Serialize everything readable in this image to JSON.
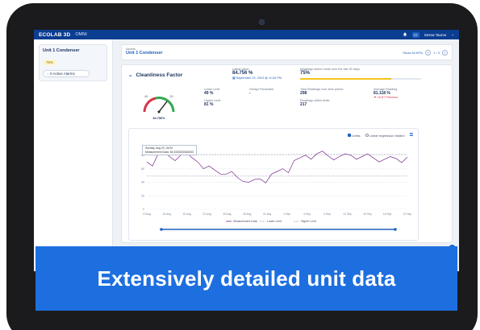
{
  "header": {
    "brand": "ECOLAB 3D",
    "app": "OMNI",
    "user_initials": "ST",
    "user_name": "Sesna Taurus"
  },
  "sidebar": {
    "unit_title": "Unit 1 Condenser",
    "unit_pct": "75%",
    "alarms": "0 Active Alarms"
  },
  "assets": {
    "label": "Assets",
    "unit": "Unit 1 Condenser",
    "show_all": "Show All KPIs",
    "page": "1 / 3"
  },
  "panel": {
    "title": "Cleanliness Factor",
    "latest_label": "Latest value",
    "latest_value": "84.756 %",
    "latest_date": "September 23, 2023 @ 11:00 PM",
    "within_label": "Readings within Limits over the last 30 days",
    "within_value": "75%",
    "within_fill": 0.75,
    "gauge_value": "84.756%",
    "gauge_low": "49",
    "gauge_high": "81",
    "lower_limit_label": "Lower Limit",
    "lower_limit_value": "49 %",
    "higher_limit_label": "Higher Limit",
    "higher_limit_value": "81 %",
    "design_label": "Design Parameter",
    "design_value": "-",
    "total_label": "Total Readings over time period",
    "total_value": "298",
    "within_count_label": "Readings within limits",
    "within_count_value": "217",
    "avg_label": "Average Reading",
    "avg_value": "81.118 %",
    "avg_delta": "10.87 Previous"
  },
  "chart_controls": {
    "limits": "Limits",
    "regression": "Linear regression hidden"
  },
  "tooltip": {
    "date": "Sunday, Aug 20, 04:00",
    "measurement": "Measurement Data: 84.3333333333333"
  },
  "chart_data": {
    "type": "line",
    "x": [
      "13 Aug",
      "16 Aug",
      "19 Aug",
      "22 Aug",
      "25 Aug",
      "28 Aug",
      "31 Aug",
      "3 Sep",
      "6 Sep",
      "9 Sep",
      "12 Sep",
      "15 Sep",
      "18 Sep",
      "21 Sep"
    ],
    "ylim": [
      0,
      100
    ],
    "yticks": [
      0,
      20,
      40,
      60,
      80
    ],
    "lower_limit": 49,
    "higher_limit": 81,
    "series": [
      {
        "name": "Measurement Data",
        "color": "#7a2b8f",
        "values": [
          70,
          82,
          78,
          80,
          76,
          60,
          58,
          52,
          47,
          40,
          45,
          52,
          60,
          72,
          80,
          82,
          79,
          78,
          80,
          78,
          76,
          74,
          75,
          77
        ]
      },
      {
        "name": "Lower Limit",
        "color": "#9aa3b3",
        "values": []
      },
      {
        "name": "Higher Limit",
        "color": "#9aa3b3",
        "values": []
      }
    ]
  },
  "banner": {
    "text": "Extensively detailed unit data"
  }
}
